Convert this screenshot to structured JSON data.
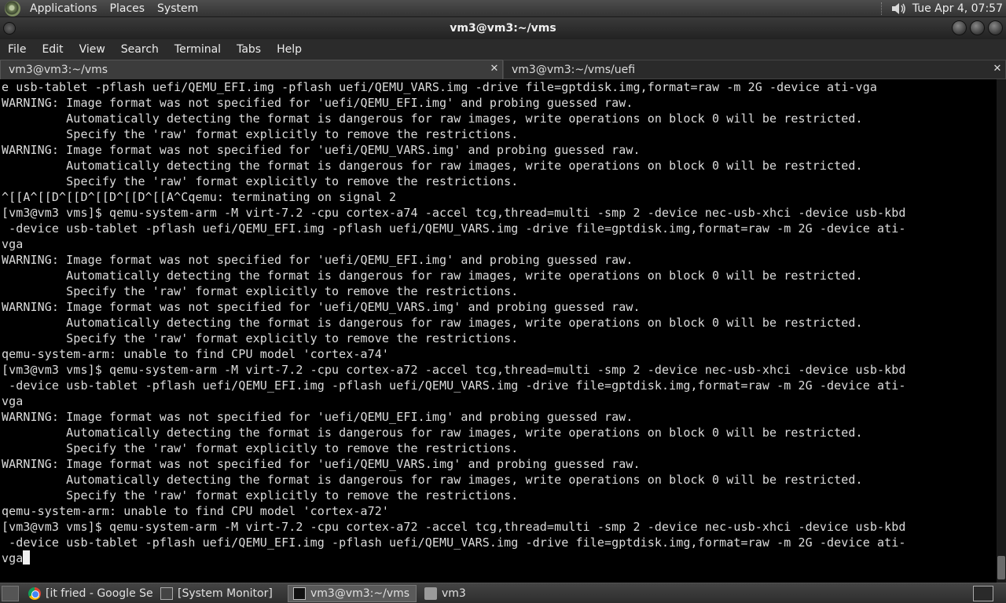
{
  "top_panel": {
    "menus": [
      "Applications",
      "Places",
      "System"
    ],
    "clock": "Tue Apr  4, 07:57"
  },
  "window": {
    "title": "vm3@vm3:~/vms"
  },
  "menubar": [
    "File",
    "Edit",
    "View",
    "Search",
    "Terminal",
    "Tabs",
    "Help"
  ],
  "tabs": [
    {
      "label": "vm3@vm3:~/vms",
      "close": "✕"
    },
    {
      "label": "vm3@vm3:~/vms/uefi",
      "close": "✕"
    }
  ],
  "terminal": {
    "lines": [
      "e usb-tablet -pflash uefi/QEMU_EFI.img -pflash uefi/QEMU_VARS.img -drive file=gptdisk.img,format=raw -m 2G -device ati-vga",
      "WARNING: Image format was not specified for 'uefi/QEMU_EFI.img' and probing guessed raw.",
      "         Automatically detecting the format is dangerous for raw images, write operations on block 0 will be restricted.",
      "         Specify the 'raw' format explicitly to remove the restrictions.",
      "WARNING: Image format was not specified for 'uefi/QEMU_VARS.img' and probing guessed raw.",
      "         Automatically detecting the format is dangerous for raw images, write operations on block 0 will be restricted.",
      "         Specify the 'raw' format explicitly to remove the restrictions.",
      "^[[A^[[D^[[D^[[D^[[D^[[A^Cqemu: terminating on signal 2",
      "[vm3@vm3 vms]$ qemu-system-arm -M virt-7.2 -cpu cortex-a74 -accel tcg,thread=multi -smp 2 -device nec-usb-xhci -device usb-kbd",
      " -device usb-tablet -pflash uefi/QEMU_EFI.img -pflash uefi/QEMU_VARS.img -drive file=gptdisk.img,format=raw -m 2G -device ati-",
      "vga",
      "WARNING: Image format was not specified for 'uefi/QEMU_EFI.img' and probing guessed raw.",
      "         Automatically detecting the format is dangerous for raw images, write operations on block 0 will be restricted.",
      "         Specify the 'raw' format explicitly to remove the restrictions.",
      "WARNING: Image format was not specified for 'uefi/QEMU_VARS.img' and probing guessed raw.",
      "         Automatically detecting the format is dangerous for raw images, write operations on block 0 will be restricted.",
      "         Specify the 'raw' format explicitly to remove the restrictions.",
      "qemu-system-arm: unable to find CPU model 'cortex-a74'",
      "[vm3@vm3 vms]$ qemu-system-arm -M virt-7.2 -cpu cortex-a72 -accel tcg,thread=multi -smp 2 -device nec-usb-xhci -device usb-kbd",
      " -device usb-tablet -pflash uefi/QEMU_EFI.img -pflash uefi/QEMU_VARS.img -drive file=gptdisk.img,format=raw -m 2G -device ati-",
      "vga",
      "WARNING: Image format was not specified for 'uefi/QEMU_EFI.img' and probing guessed raw.",
      "         Automatically detecting the format is dangerous for raw images, write operations on block 0 will be restricted.",
      "         Specify the 'raw' format explicitly to remove the restrictions.",
      "WARNING: Image format was not specified for 'uefi/QEMU_VARS.img' and probing guessed raw.",
      "         Automatically detecting the format is dangerous for raw images, write operations on block 0 will be restricted.",
      "         Specify the 'raw' format explicitly to remove the restrictions.",
      "qemu-system-arm: unable to find CPU model 'cortex-a72'",
      "[vm3@vm3 vms]$ qemu-system-arm -M virt-7.2 -cpu cortex-a72 -accel tcg,thread=multi -smp 2 -device nec-usb-xhci -device usb-kbd",
      " -device usb-tablet -pflash uefi/QEMU_EFI.img -pflash uefi/QEMU_VARS.img -drive file=gptdisk.img,format=raw -m 2G -device ati-",
      "vga"
    ]
  },
  "taskbar": {
    "tasks": [
      {
        "label": "[it fried - Google Sea...",
        "icon": "chrome-icon"
      },
      {
        "label": "[System Monitor]",
        "icon": "system-monitor-icon"
      },
      {
        "label": "vm3@vm3:~/vms",
        "icon": "terminal-icon"
      },
      {
        "label": "vm3",
        "icon": "folder-icon"
      }
    ]
  }
}
